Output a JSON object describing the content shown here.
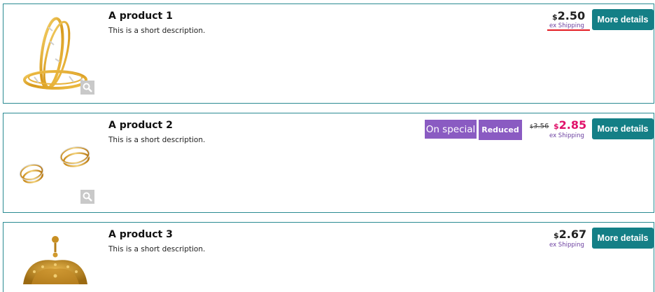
{
  "products": [
    {
      "title": "A product 1",
      "description": "This is a short description.",
      "price_currency": "$",
      "price": "2.50",
      "shipping_note": "ex Shipping",
      "button_label": "More details"
    },
    {
      "title": "A product 2",
      "description": "This is a short description.",
      "badge_special": "On special",
      "badge_reduced": "Reduced",
      "old_price_currency": "$",
      "old_price": "3.56",
      "price_currency": "$",
      "price": "2.85",
      "shipping_note": "ex Shipping",
      "button_label": "More details"
    },
    {
      "title": "A product 3",
      "description": "This is a short description.",
      "price_currency": "$",
      "price": "2.67",
      "shipping_note": "ex Shipping",
      "button_label": "More details"
    }
  ],
  "colors": {
    "card_border": "#2a8a92",
    "button_bg": "#147f86",
    "badge_bg": "#8a5bc2",
    "special_price": "#e0116a",
    "shipping_text": "#6b3fa0",
    "underline": "#e31b23"
  },
  "icons": {
    "zoom": "magnifier-icon"
  }
}
